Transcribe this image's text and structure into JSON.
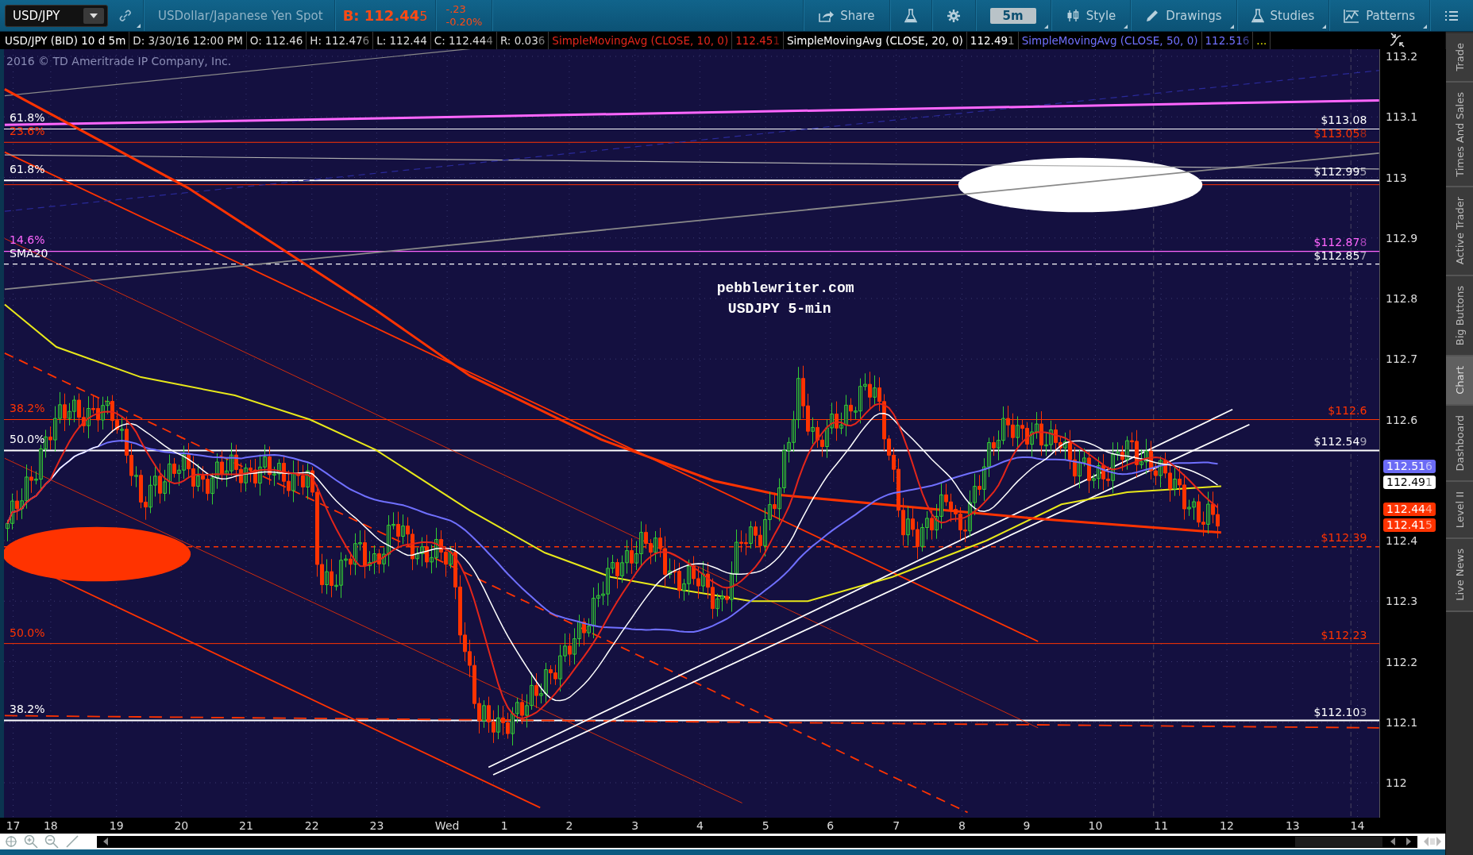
{
  "toolbar": {
    "symbol": "USD/JPY",
    "description": "USDollar/Japanese Yen Spot",
    "bid": {
      "price": "B: 112.44",
      "tail": "5"
    },
    "change": "-.23",
    "change_percent": "-0.20%",
    "buttons": [
      {
        "kind": "share",
        "label": "Share",
        "has_menu": false
      },
      {
        "kind": "flask",
        "has_menu": false
      },
      {
        "kind": "gear",
        "has_menu": false
      },
      {
        "kind": "period",
        "label": "5m",
        "has_menu": true
      },
      {
        "kind": "style",
        "label": "Style",
        "has_menu": true
      },
      {
        "kind": "drawings",
        "label": "Drawings",
        "has_menu": true
      },
      {
        "kind": "studies",
        "label": "Studies",
        "has_menu": true
      },
      {
        "kind": "patterns",
        "label": "Patterns",
        "has_menu": true
      },
      {
        "kind": "menu",
        "has_menu": false
      }
    ]
  },
  "info_bar": {
    "header": "USD/JPY (BID) 10 d 5m",
    "fields": [
      {
        "text": "D: 3/30/16 12:00 PM"
      },
      {
        "text": "O: 112.46"
      },
      {
        "text": "H: 112.47",
        "tail": "6"
      },
      {
        "text": "L: 112.44"
      },
      {
        "text": "C: 112.44",
        "tail": "4"
      },
      {
        "text": "R: 0.03",
        "tail": "6"
      }
    ],
    "studies": [
      {
        "name": "SimpleMovingAvg (CLOSE, 10, 0)",
        "value": "112.45",
        "tail": "1",
        "color": "#e3261b"
      },
      {
        "name": "SimpleMovingAvg (CLOSE, 20, 0)",
        "value": "112.49",
        "tail": "1",
        "color": "#ffffff"
      },
      {
        "name": "SimpleMovingAvg (CLOSE, 50, 0)",
        "value": "112.51",
        "tail": "6",
        "color": "#7070ff"
      }
    ],
    "more": "..."
  },
  "chart": {
    "copyright": "2016 © TD Ameritrade IP Company, Inc.",
    "annotations": [
      "pebblewriter.com",
      "USDJPY 5-min"
    ],
    "left_labels": [
      {
        "text": "61.8%",
        "color": "#ffffff"
      },
      {
        "text": "23.6%",
        "color": "#ff3300"
      },
      {
        "text": "61.8%",
        "color": "#ffffff"
      },
      {
        "text": "14.6%",
        "color": "#ff66ff"
      },
      {
        "text": "SMA20",
        "color": "#ffffff"
      },
      {
        "text": "38.2%",
        "color": "#ff3300"
      },
      {
        "text": "50.0%",
        "color": "#ffffff"
      },
      {
        "text": "50.0%",
        "color": "#ff3300"
      },
      {
        "text": "38.2%",
        "color": "#ffffff"
      }
    ],
    "right_labels": [
      {
        "price": "$113.08",
        "color": "#ffffff"
      },
      {
        "price": "$113.05",
        "tail": "8",
        "color": "#ff3300"
      },
      {
        "price": "$112.99",
        "tail": "5",
        "color": "#ffffff"
      },
      {
        "price": "$112.87",
        "tail": "8",
        "color": "#ff66ff"
      },
      {
        "price": "$112.85",
        "tail": "7",
        "color": "#ffffff"
      },
      {
        "price": "$112.6",
        "color": "#ff3300"
      },
      {
        "price": "$112.54",
        "tail": "9",
        "color": "#ffffff"
      },
      {
        "price": "$112.39",
        "color": "#ff3300"
      },
      {
        "price": "$112.23",
        "color": "#ff3300"
      },
      {
        "price": "$112.10",
        "tail": "3",
        "color": "#ffffff"
      }
    ],
    "price_axis": [
      "113.2",
      "113.1",
      "113",
      "112.9",
      "112.8",
      "112.7",
      "112.6",
      "112.4",
      "112.3",
      "112.2",
      "112.1",
      "112"
    ],
    "price_tags": [
      {
        "price": "112.51",
        "tail": "6",
        "color": "#6b6bf5"
      },
      {
        "price": "112.49",
        "tail": "1",
        "color": "#ffffff"
      },
      {
        "price": "112.44",
        "tail": "4",
        "color": "#ff3300"
      },
      {
        "price": "112.41",
        "tail": "5",
        "color": "#ff3300"
      }
    ],
    "time_axis": [
      "17",
      "18",
      "19",
      "20",
      "21",
      "22",
      "23",
      "Wed",
      "1",
      "2",
      "3",
      "4",
      "5",
      "6",
      "7",
      "8",
      "9",
      "10",
      "11",
      "12",
      "13",
      "14"
    ]
  },
  "side_tabs": [
    {
      "label": "Trade",
      "selected": false
    },
    {
      "label": "Times And Sales",
      "selected": false
    },
    {
      "label": "Active Trader",
      "selected": false
    },
    {
      "label": "Big Buttons",
      "selected": false
    },
    {
      "label": "Chart",
      "selected": true
    },
    {
      "label": "Dashboard",
      "selected": false
    },
    {
      "label": "Level II",
      "selected": false
    },
    {
      "label": "Live News",
      "selected": false
    }
  ]
}
